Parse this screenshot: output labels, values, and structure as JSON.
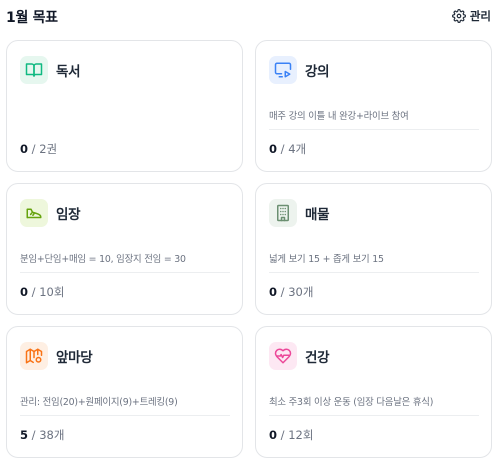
{
  "header": {
    "title": "1월 목표",
    "manage_label": "관리",
    "manage_icon": "gear-icon"
  },
  "cards": [
    {
      "title": "독서",
      "icon": "book-open-icon",
      "icon_color": "#10b981",
      "icon_bg": "#e6f7ef",
      "description": "",
      "current": "0",
      "target": "2권"
    },
    {
      "title": "강의",
      "icon": "video-lecture-icon",
      "icon_color": "#3b82f6",
      "icon_bg": "#e8f0fe",
      "description": "매주 강의 이틀 내 완강+라이브 참여",
      "current": "0",
      "target": "4개"
    },
    {
      "title": "임장",
      "icon": "walking-shoe-icon",
      "icon_color": "#65a30d",
      "icon_bg": "#eef7dc",
      "description": "분임+단임+매임 = 10, 임장지 전임 = 30",
      "current": "0",
      "target": "10회"
    },
    {
      "title": "매물",
      "icon": "building-icon",
      "icon_color": "#6b8f71",
      "icon_bg": "#edf3ee",
      "description": "넓게 보기 15 + 좁게 보기 15",
      "current": "0",
      "target": "30개"
    },
    {
      "title": "앞마당",
      "icon": "map-pin-icon",
      "icon_color": "#f97316",
      "icon_bg": "#feefe3",
      "description": "관리: 전임(20)+원페이지(9)+트레킹(9)",
      "current": "5",
      "target": "38개"
    },
    {
      "title": "건강",
      "icon": "heart-pulse-icon",
      "icon_color": "#ec4899",
      "icon_bg": "#fde8f3",
      "description": "최소 주3회 이상 운동 (임장 다음날은 휴식)",
      "current": "0",
      "target": "12회"
    }
  ]
}
